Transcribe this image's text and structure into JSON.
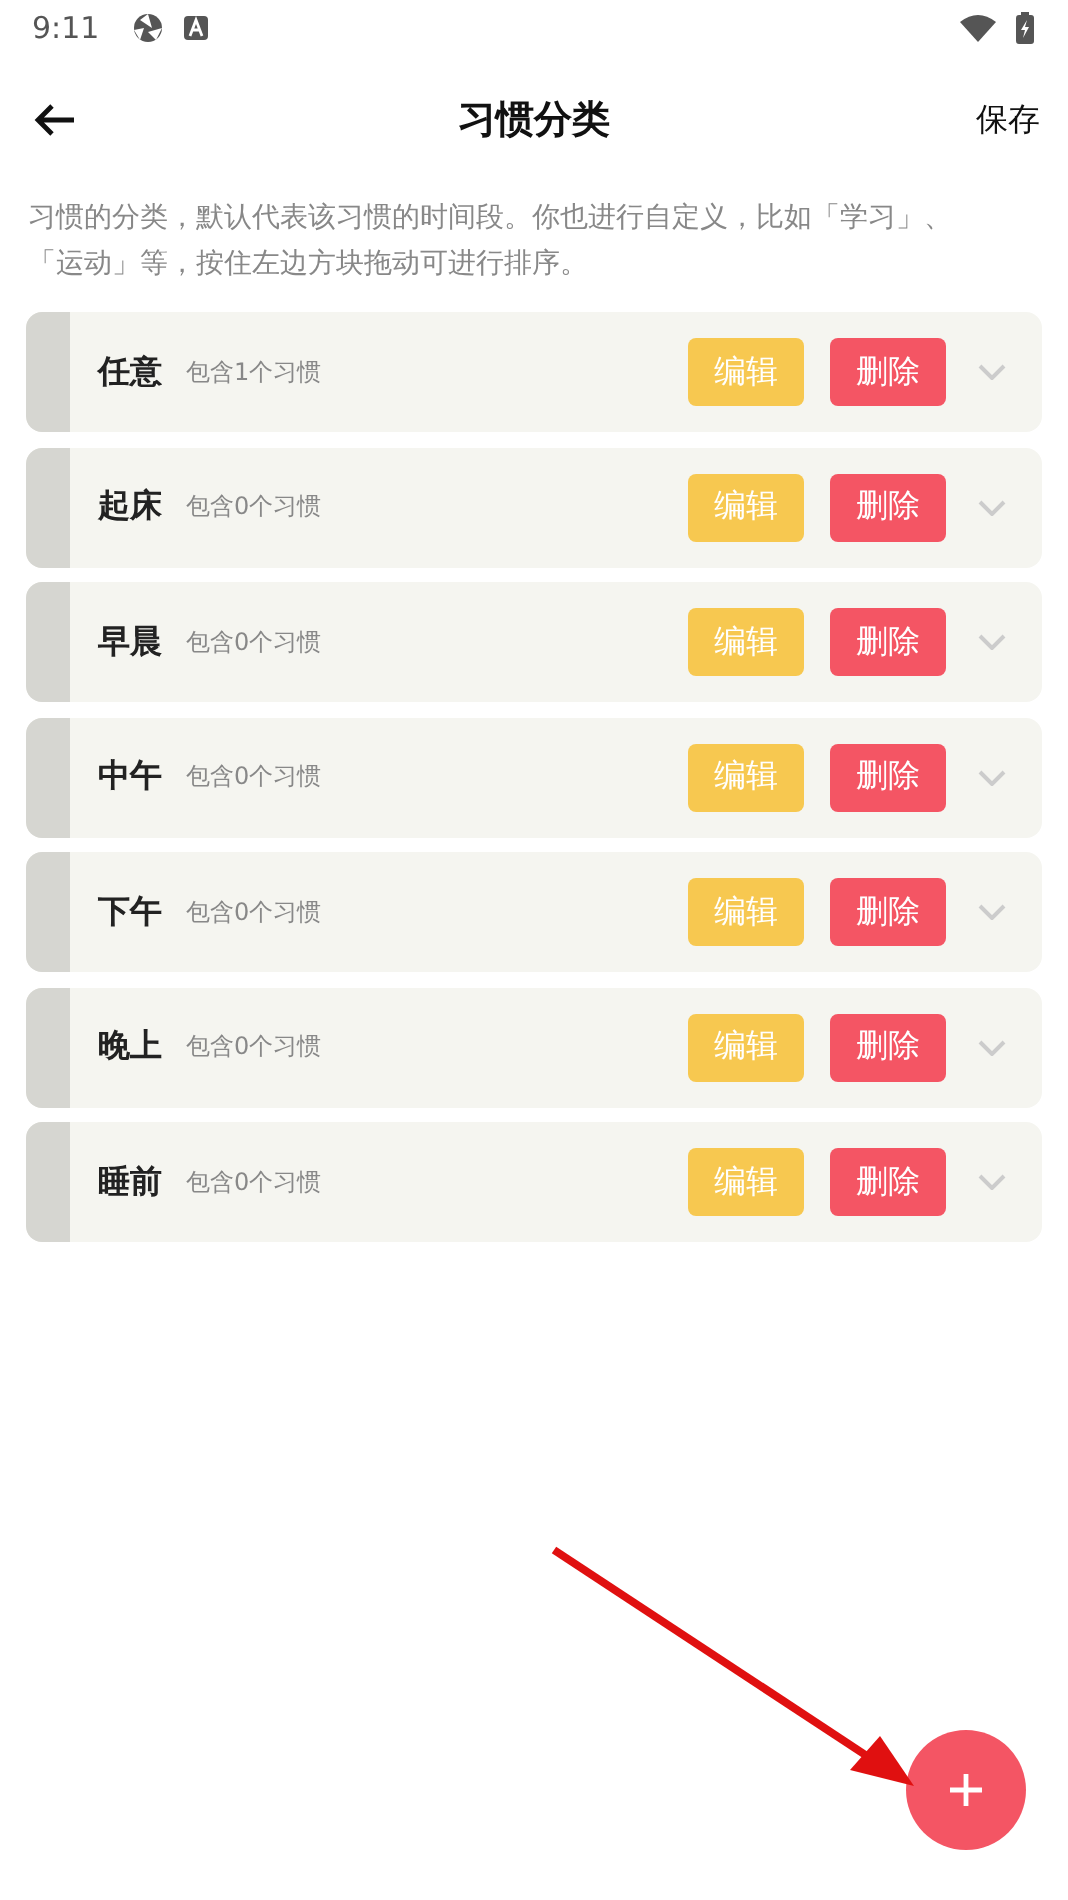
{
  "status_bar": {
    "time": "9:11"
  },
  "header": {
    "title": "习惯分类",
    "action": "保存"
  },
  "description": "习惯的分类，默认代表该习惯的时间段。你也进行自定义，比如「学习」、「运动」等，按住左边方块拖动可进行排序。",
  "categories": [
    {
      "name": "任意",
      "count": "包含1个习惯",
      "edit": "编辑",
      "delete": "删除"
    },
    {
      "name": "起床",
      "count": "包含0个习惯",
      "edit": "编辑",
      "delete": "删除"
    },
    {
      "name": "早晨",
      "count": "包含0个习惯",
      "edit": "编辑",
      "delete": "删除"
    },
    {
      "name": "中午",
      "count": "包含0个习惯",
      "edit": "编辑",
      "delete": "删除"
    },
    {
      "name": "下午",
      "count": "包含0个习惯",
      "edit": "编辑",
      "delete": "删除"
    },
    {
      "name": "晚上",
      "count": "包含0个习惯",
      "edit": "编辑",
      "delete": "删除"
    },
    {
      "name": "睡前",
      "count": "包含0个习惯",
      "edit": "编辑",
      "delete": "删除"
    }
  ]
}
